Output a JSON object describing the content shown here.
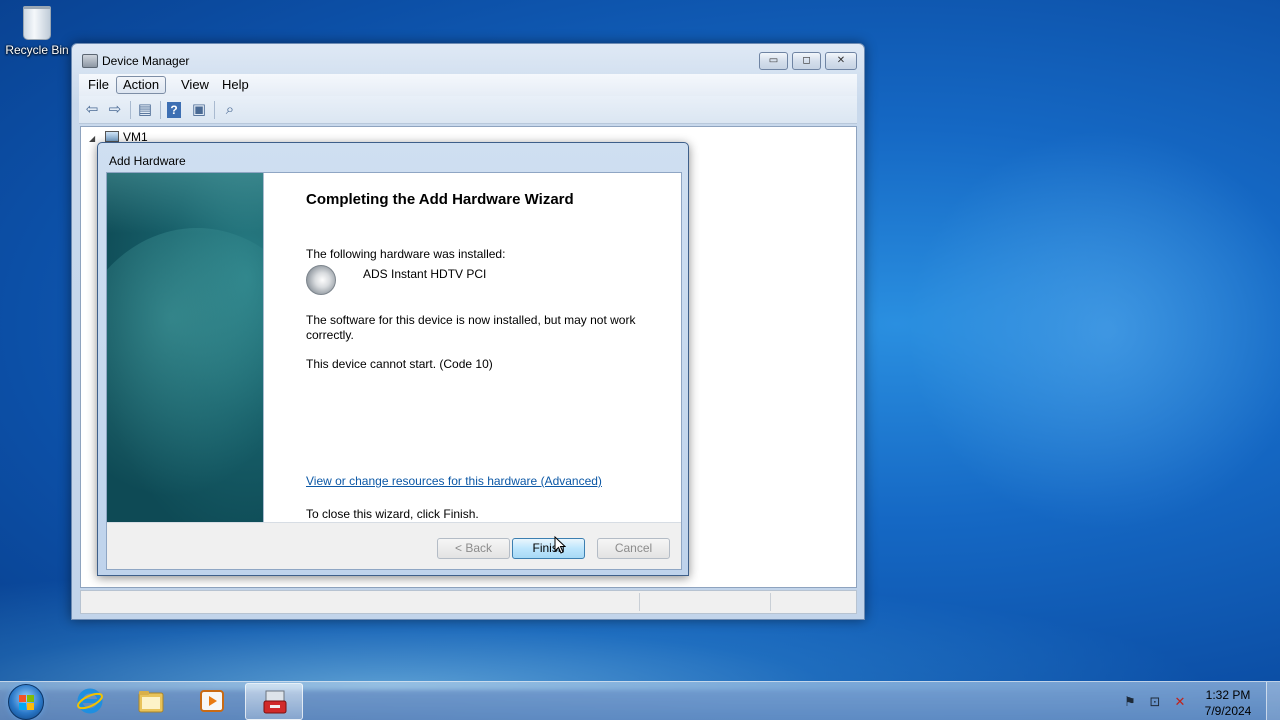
{
  "desktop": {
    "icons": [
      {
        "label": "Recycle Bin",
        "icon": "recycle-bin-icon"
      }
    ]
  },
  "device_manager": {
    "title": "Device Manager",
    "window_buttons": {
      "minimize": "▭",
      "maximize": "◻",
      "close": "✕"
    },
    "menu": [
      "File",
      "Action",
      "View",
      "Help"
    ],
    "active_menu": "Action",
    "toolbar_icons": [
      "back-arrow-icon",
      "forward-arrow-icon",
      "properties-icon",
      "help-icon",
      "view-icon",
      "scan-hardware-icon"
    ],
    "tree_root": "VM1"
  },
  "wizard": {
    "title": "Add Hardware",
    "heading": "Completing the Add Hardware Wizard",
    "installed_label": "The following hardware was installed:",
    "device_name": "ADS Instant HDTV PCI",
    "device_icon": "speaker-icon",
    "warning_text": "The software for this device is now installed, but may not work correctly.",
    "error_text": "This device cannot start. (Code 10)",
    "advanced_link": "View or change resources for this hardware (Advanced)",
    "close_instruction": "To close this wizard, click Finish.",
    "buttons": {
      "back": "< Back",
      "finish": "Finish",
      "cancel": "Cancel"
    }
  },
  "taskbar": {
    "apps": [
      "internet-explorer-icon",
      "file-explorer-icon",
      "media-player-icon",
      "device-manager-taskbar-icon"
    ],
    "active_app": "device-manager-taskbar-icon",
    "tray_icons": [
      "action-center-flag-icon",
      "network-icon",
      "volume-muted-icon"
    ],
    "time": "1:32 PM",
    "date": "7/9/2024"
  },
  "colors": {
    "desktop": "#1568c4",
    "link": "#0c58a6",
    "wizard_banner": "#175f69"
  }
}
